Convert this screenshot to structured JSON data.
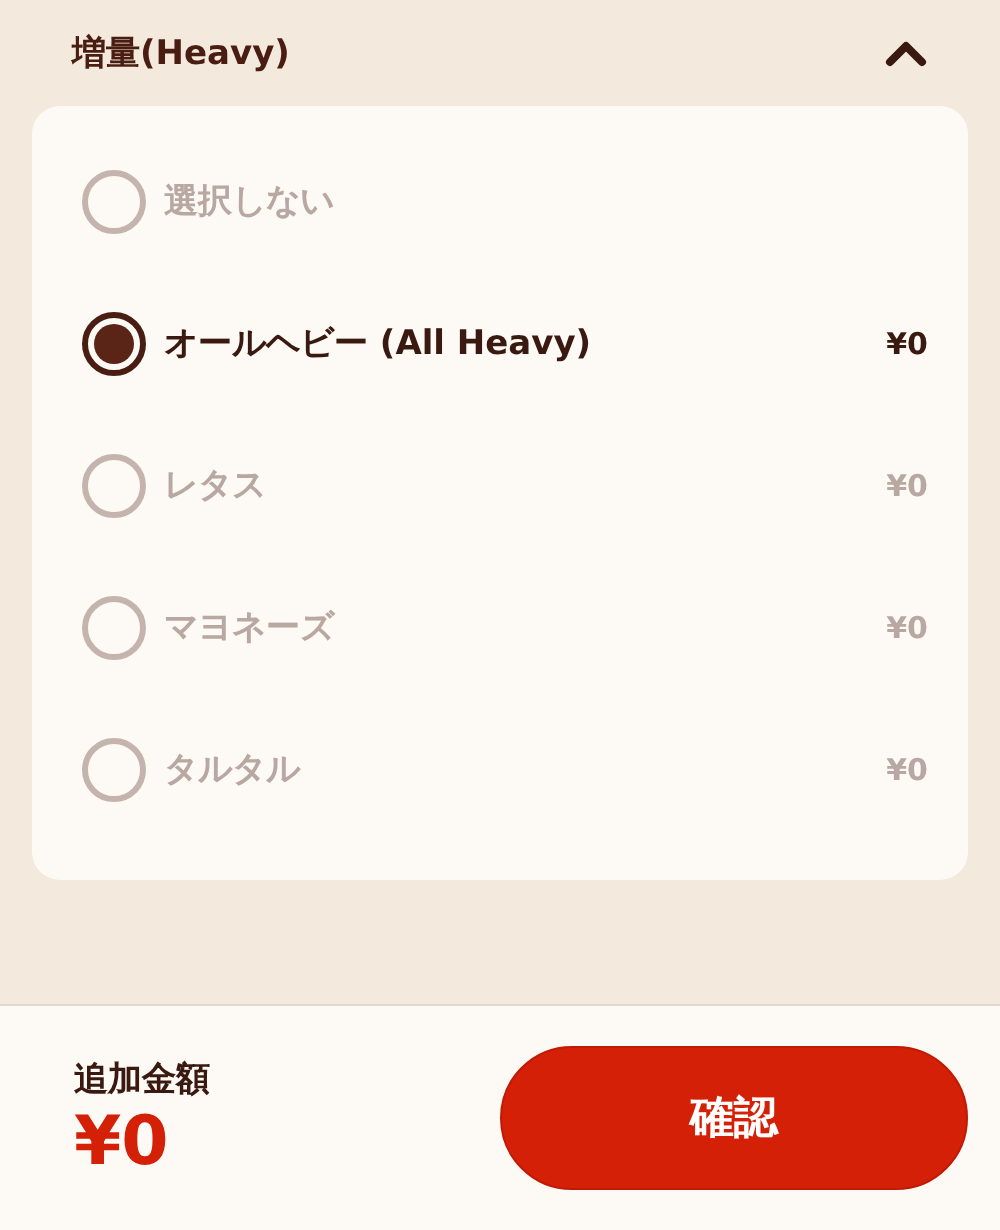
{
  "section": {
    "title": "増量(Heavy)",
    "expanded": true
  },
  "options": [
    {
      "label": "選択しない",
      "selected": false
    },
    {
      "label": "オールヘビー (All Heavy)",
      "price": "¥0",
      "selected": true
    },
    {
      "label": "レタス",
      "price": "¥0",
      "selected": false
    },
    {
      "label": "マヨネーズ",
      "price": "¥0",
      "selected": false
    },
    {
      "label": "タルタル",
      "price": "¥0",
      "selected": false
    }
  ],
  "footer": {
    "label": "追加金額",
    "total": "¥0",
    "button": "確認"
  }
}
